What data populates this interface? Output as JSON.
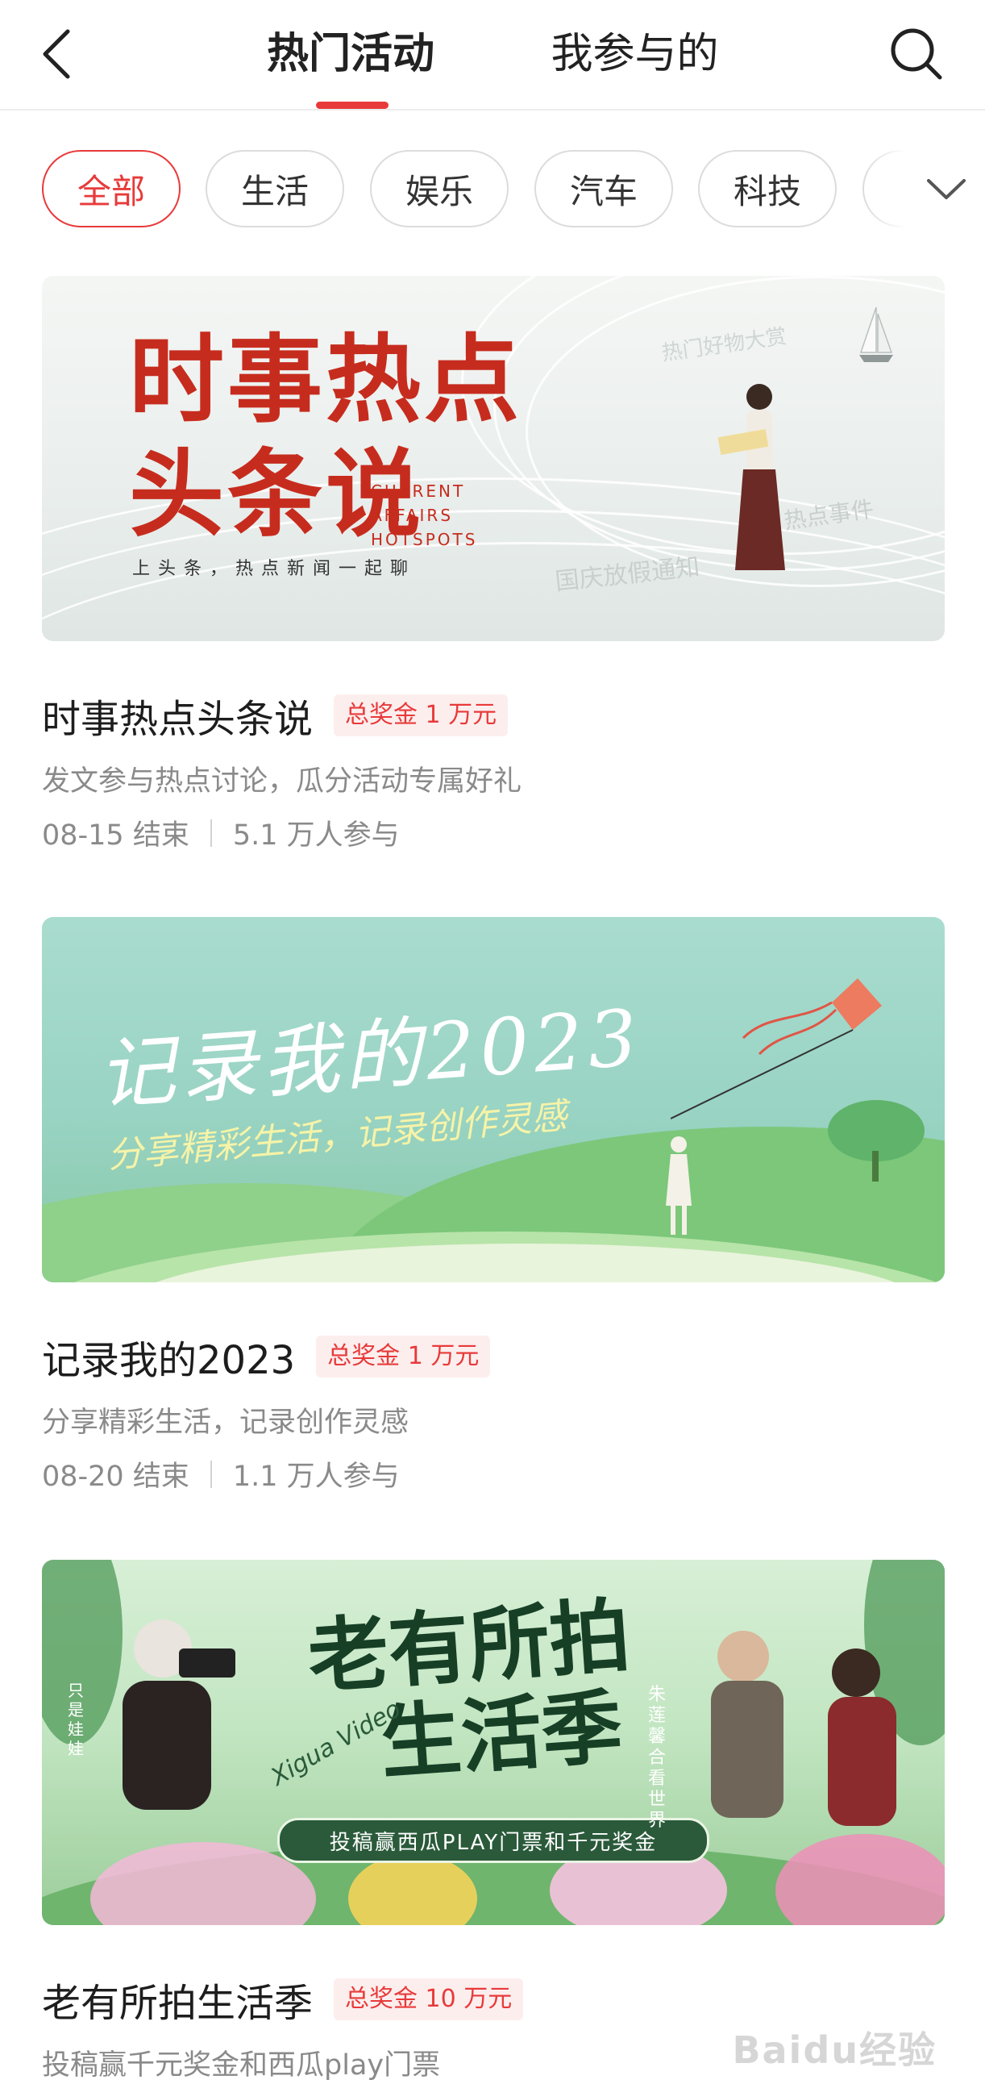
{
  "header": {
    "tabs": [
      {
        "label": "热门活动",
        "active": true
      },
      {
        "label": "我参与的",
        "active": false
      }
    ],
    "back_icon": "chevron-left-icon",
    "search_icon": "search-icon",
    "accent_color": "#e83a3a"
  },
  "categories": {
    "items": [
      "全部",
      "生活",
      "娱乐",
      "汽车",
      "科技"
    ],
    "selected": "全部",
    "more_icon": "chevron-down-icon"
  },
  "activities": [
    {
      "banner": {
        "title_line1": "时事热点",
        "title_line2": "头条说",
        "english": [
          "CURRENT",
          "AFFAIRS",
          "HOTSPOTS"
        ],
        "subtitle": "上头条，热点新闻一起聊",
        "faint_texts": [
          "热门好物大赏",
          "国庆放假通知",
          "热点事件"
        ]
      },
      "title": "时事热点头条说",
      "prize": "总奖金 1 万元",
      "desc": "发文参与热点讨论，瓜分活动专属好礼",
      "end_date": "08-15 结束",
      "participants": "5.1 万人参与"
    },
    {
      "banner": {
        "title": "记录我的2023",
        "subtitle": "分享精彩生活，记录创作灵感"
      },
      "title": "记录我的2023",
      "prize": "总奖金 1 万元",
      "desc": "分享精彩生活，记录创作灵感",
      "end_date": "08-20 结束",
      "participants": "1.1 万人参与"
    },
    {
      "banner": {
        "title_line1": "老有所拍",
        "title_line2": "生活季",
        "xigua": "Xigua Video",
        "pill": "投稿赢西瓜PLAY门票和千元奖金",
        "side_right": "朱莲馨 合看世界",
        "side_left": "只是娃娃"
      },
      "title": "老有所拍生活季",
      "prize": "总奖金 10 万元",
      "desc": "投稿赢千元奖金和西瓜play门票"
    }
  ],
  "watermark": "Baidu经验"
}
